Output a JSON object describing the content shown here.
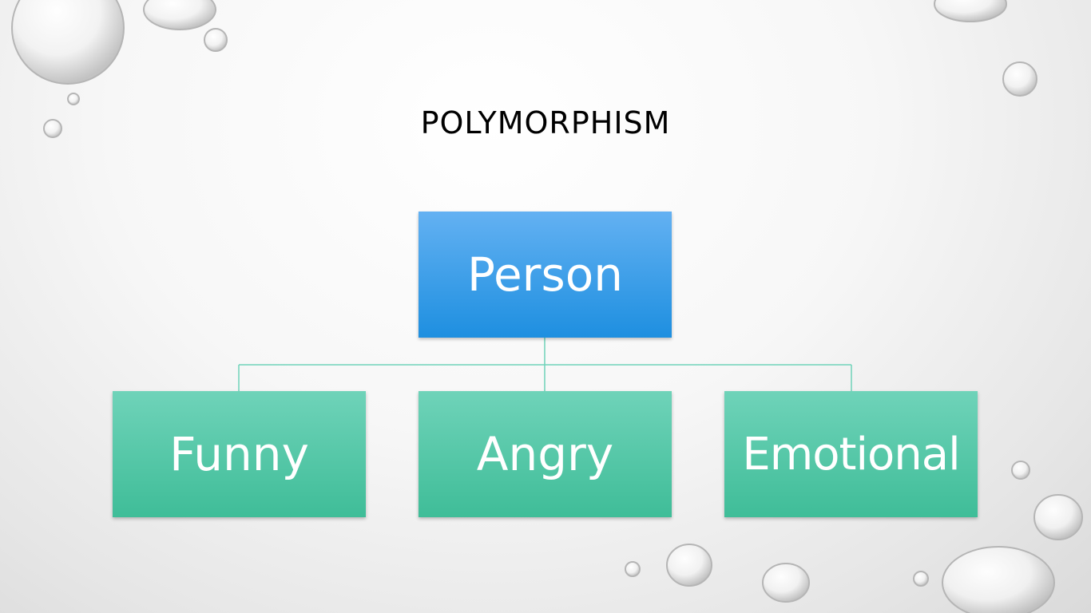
{
  "slide": {
    "title": "POLYMORPHISM"
  },
  "diagram": {
    "root": {
      "label": "Person",
      "color": "#2f9be6"
    },
    "children": [
      {
        "label": "Funny",
        "color": "#4cc4a2"
      },
      {
        "label": "Angry",
        "color": "#4cc4a2"
      },
      {
        "label": "Emotional",
        "color": "#4cc4a2"
      }
    ],
    "connector_color": "#6fd3b9"
  }
}
